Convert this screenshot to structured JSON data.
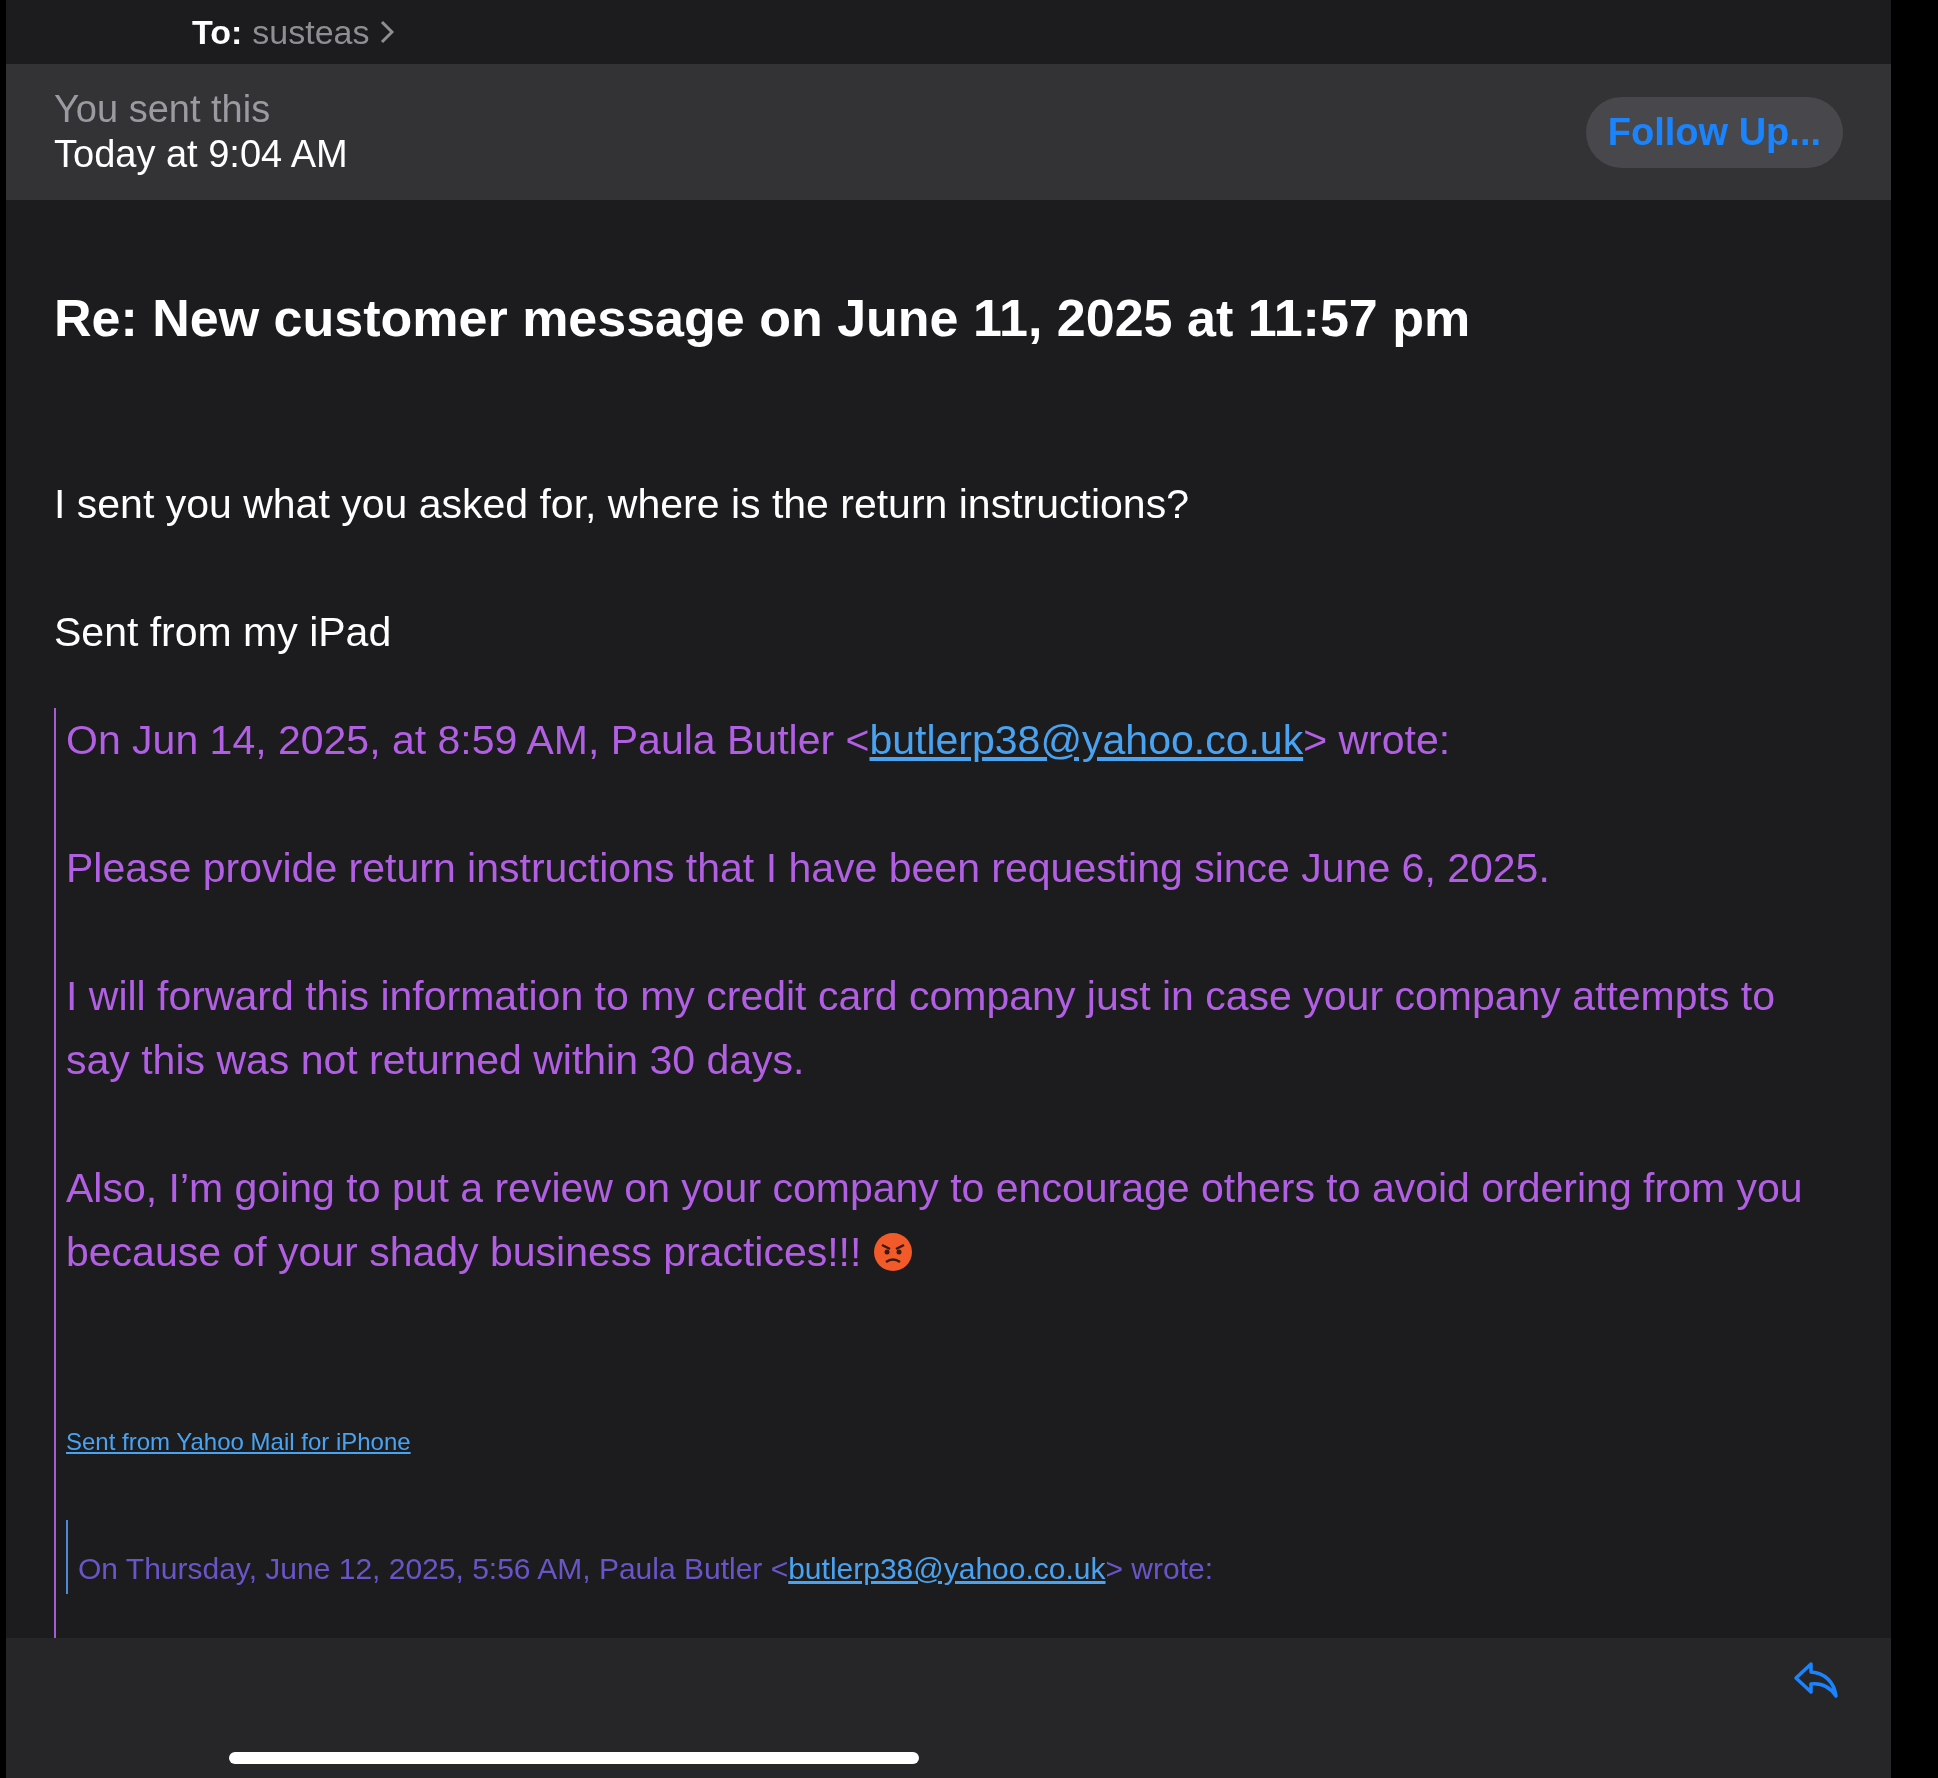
{
  "recipient": {
    "label": "To:",
    "name": "susteas"
  },
  "header": {
    "status": "You sent this",
    "date": "Today at 9:04 AM",
    "follow_up": "Follow Up..."
  },
  "subject": "Re: New customer message on June 11, 2025 at 11:57 pm",
  "body": [
    "I sent you what you asked for, where is the return instructions?",
    "Sent from my iPad"
  ],
  "quote": {
    "before": "On Jun 14, 2025, at 8:59 AM, Paula Butler <",
    "email": "butlerp38@yahoo.co.uk",
    "after": "> wrote:",
    "paragraphs": [
      {
        "text": "Please provide return instructions that I have been requesting since June 6, 2025.",
        "emoji": false
      },
      {
        "text": "I will forward this information to my credit card company just in case your company attempts to say this was not returned within 30 days.",
        "emoji": false
      },
      {
        "text": "Also, I’m going to put a review on your company to encourage others to avoid ordering from you because of your shady business practices!!!",
        "emoji": true
      }
    ],
    "signature": "Sent from Yahoo Mail for iPhone",
    "nested": {
      "before": "On Thursday, June 12, 2025, 5:56 AM, Paula Butler <",
      "email": "butlerp38@yahoo.co.uk",
      "after": "> wrote:"
    }
  }
}
